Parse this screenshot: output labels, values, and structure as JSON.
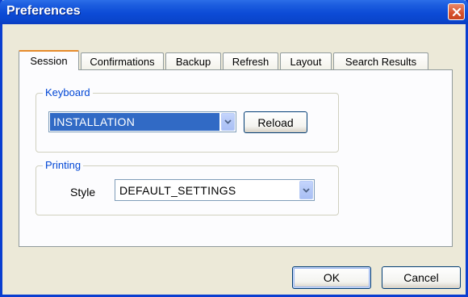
{
  "window": {
    "title": "Preferences",
    "close_icon": "close-icon"
  },
  "tabs": [
    {
      "label": "Session",
      "active": true
    },
    {
      "label": "Confirmations",
      "active": false
    },
    {
      "label": "Backup",
      "active": false
    },
    {
      "label": "Refresh",
      "active": false
    },
    {
      "label": "Layout",
      "active": false
    },
    {
      "label": "Search Results",
      "active": false
    }
  ],
  "keyboard": {
    "group_label": "Keyboard",
    "selected_value": "INSTALLATION",
    "reload_label": "Reload"
  },
  "printing": {
    "group_label": "Printing",
    "style_label": "Style",
    "selected_value": "DEFAULT_SETTINGS"
  },
  "footer": {
    "ok_label": "OK",
    "cancel_label": "Cancel"
  },
  "colors": {
    "titlebar": "#0a45cc",
    "accent_tab": "#e68b2c",
    "group_label": "#0046d5",
    "selection": "#316ac5"
  }
}
